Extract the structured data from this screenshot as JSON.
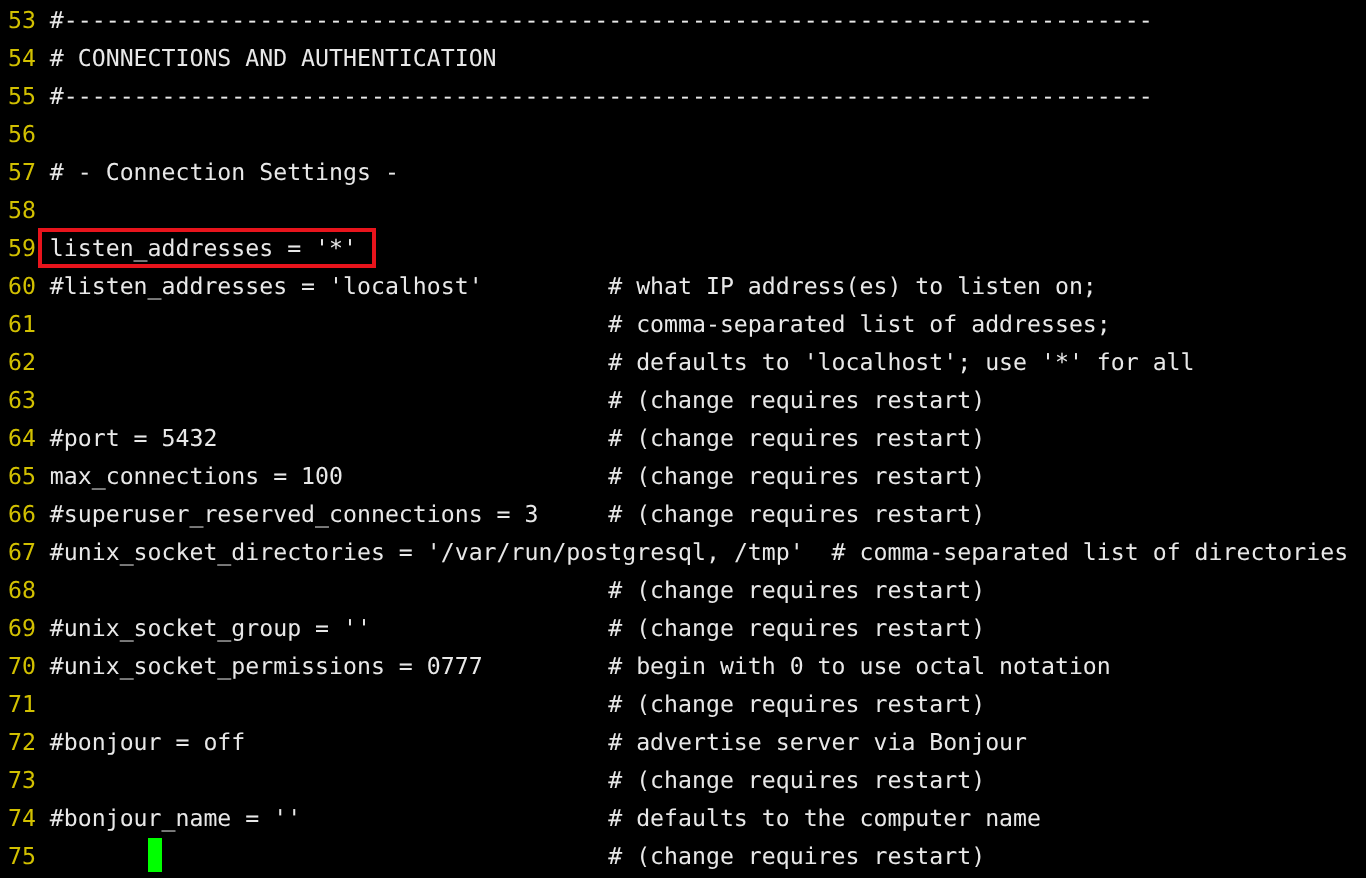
{
  "lines": [
    {
      "number": "53",
      "code": "#------------------------------------------------------------------------------",
      "highlighted": false,
      "cursor": false
    },
    {
      "number": "54",
      "code": "# CONNECTIONS AND AUTHENTICATION",
      "highlighted": false,
      "cursor": false
    },
    {
      "number": "55",
      "code": "#------------------------------------------------------------------------------",
      "highlighted": false,
      "cursor": false
    },
    {
      "number": "56",
      "highlighted": false,
      "cursor": false
    },
    {
      "number": "57",
      "code": "# - Connection Settings -",
      "highlighted": false,
      "cursor": false
    },
    {
      "number": "58",
      "highlighted": false,
      "cursor": false
    },
    {
      "number": "59",
      "code": "listen_addresses = '*'",
      "highlighted": true,
      "cursor": false
    },
    {
      "number": "60",
      "code": "#listen_addresses = 'localhost'",
      "comment": "# what IP address(es) to listen on;",
      "highlighted": false,
      "cursor": false
    },
    {
      "number": "61",
      "comment": "# comma-separated list of addresses;",
      "highlighted": false,
      "cursor": false
    },
    {
      "number": "62",
      "comment": "# defaults to 'localhost'; use '*' for all",
      "highlighted": false,
      "cursor": false
    },
    {
      "number": "63",
      "comment": "# (change requires restart)",
      "highlighted": false,
      "cursor": false
    },
    {
      "number": "64",
      "code": "#port = 5432",
      "comment": "# (change requires restart)",
      "highlighted": false,
      "cursor": false
    },
    {
      "number": "65",
      "code": "max_connections = 100",
      "comment": "# (change requires restart)",
      "highlighted": false,
      "cursor": false
    },
    {
      "number": "66",
      "code": "#superuser_reserved_connections = 3",
      "comment": "# (change requires restart)",
      "highlighted": false,
      "cursor": false
    },
    {
      "number": "67",
      "code": "#unix_socket_directories = '/var/run/postgresql, /tmp'",
      "comment": "# comma-separated list of directories",
      "highlighted": false,
      "cursor": false
    },
    {
      "number": "68",
      "comment": "# (change requires restart)",
      "highlighted": false,
      "cursor": false
    },
    {
      "number": "69",
      "code": "#unix_socket_group = ''",
      "comment": "# (change requires restart)",
      "highlighted": false,
      "cursor": false
    },
    {
      "number": "70",
      "code": "#unix_socket_permissions = 0777",
      "comment": "# begin with 0 to use octal notation",
      "highlighted": false,
      "cursor": false
    },
    {
      "number": "71",
      "comment": "# (change requires restart)",
      "highlighted": false,
      "cursor": false
    },
    {
      "number": "72",
      "code": "#bonjour = off",
      "comment": "# advertise server via Bonjour",
      "highlighted": false,
      "cursor": false
    },
    {
      "number": "73",
      "comment": "# (change requires restart)",
      "highlighted": false,
      "cursor": false
    },
    {
      "number": "74",
      "code": "#bonjour_name = ''",
      "comment": "# defaults to the computer name",
      "highlighted": false,
      "cursor": false
    },
    {
      "number": "75",
      "comment": "# (change requires restart)",
      "highlighted": false,
      "cursor": true
    }
  ]
}
